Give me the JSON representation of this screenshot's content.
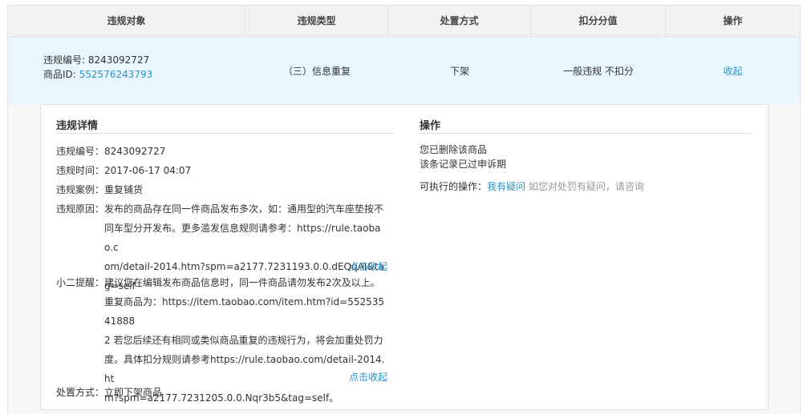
{
  "table": {
    "headers": [
      "违规对象",
      "违规类型",
      "处置方式",
      "扣分分值",
      "操作"
    ],
    "row": {
      "violation_no_label": "违规编号: ",
      "violation_no": "8243092727",
      "product_id_label": "商品ID: ",
      "product_id": "552576243793",
      "type": "（三）信息重复",
      "action": "下架",
      "score": "一般违规 不扣分",
      "op_link": "收起"
    }
  },
  "detail": {
    "title": "违规详情",
    "fields": {
      "no_label": "违规编号：",
      "no_value": "8243092727",
      "time_label": "违规时间：",
      "time_value": "2017-06-17 04:07",
      "case_label": "违规案例：",
      "case_value": "重复铺货",
      "reason_label": "违规原因：",
      "reason_lines": [
        "发布的商品存在同一件商品发布多次，如：通用型的汽车座垫按不",
        "同车型分开发布。更多滥发信息规则请参考：https://rule.taobao.c",
        "om/detail-2014.htm?spm=a2177.7231193.0.0.dEQqAI&tag=self"
      ],
      "reason_collapse": "点击收起",
      "tip_label": "小二提醒：",
      "tip_lines": [
        "建议您在编辑发布商品信息时，同一件商品请勿发布2次及以上。",
        "重复商品为：https://item.taobao.com/item.htm?id=55253541888",
        "2 若您后续还有相同或类似商品重复的违规行为，将会加重处罚力",
        "度。具体扣分规则请参考https://rule.taobao.com/detail-2014.ht",
        "m?spm=a2177.7231205.0.0.Nqr3b5&tag=self。"
      ],
      "tip_collapse": "点击收起",
      "disposal_label": "处置方式：",
      "disposal_value": "立即下架商品"
    }
  },
  "operation": {
    "title": "操作",
    "line1": "您已删除该商品",
    "line2": "该条记录已过申诉期",
    "available_label": "可执行的操作：",
    "doubt_link": "我有疑问",
    "hint": " 如您对处罚有疑问，请咨询"
  },
  "colors": {
    "link": "#2d93ca",
    "row_highlight": "#e8f6fd",
    "header_bg": "#f2f2f2"
  }
}
